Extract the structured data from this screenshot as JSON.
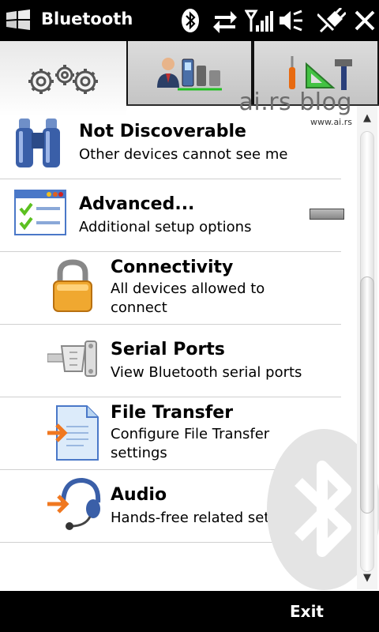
{
  "titlebar": {
    "title": "Bluetooth"
  },
  "status_icons": [
    "bluetooth-icon",
    "data-sync-icon",
    "signal-strength-icon",
    "speaker-icon",
    "power-connected-icon",
    "close-icon"
  ],
  "tabs": [
    {
      "name": "gears-tab",
      "icon": "gears-icon",
      "active": true
    },
    {
      "name": "devices-tab",
      "icon": "person-devices-icon",
      "active": false
    },
    {
      "name": "tools-tab",
      "icon": "tools-icon",
      "active": false
    }
  ],
  "watermark": {
    "title": "ai.rs blog",
    "url": "www.ai.rs"
  },
  "list": {
    "items": [
      {
        "title": "Not Discoverable",
        "subtitle": "Other devices cannot see me",
        "icon": "binoculars-icon"
      },
      {
        "title": "Advanced...",
        "subtitle": "Additional setup options",
        "icon": "checklist-icon"
      },
      {
        "title": "Connectivity",
        "subtitle": "All devices allowed to connect",
        "icon": "lock-icon"
      },
      {
        "title": "Serial Ports",
        "subtitle": "View Bluetooth serial ports",
        "icon": "serial-port-icon"
      },
      {
        "title": "File Transfer",
        "subtitle": "Configure File Transfer settings",
        "icon": "file-transfer-icon"
      },
      {
        "title": "Audio",
        "subtitle": "Hands-free related settings",
        "icon": "headset-icon"
      }
    ]
  },
  "softkeys": {
    "right": "Exit"
  },
  "colors": {
    "bar": "#000000",
    "accent_orange": "#f07820",
    "icon_blue": "#3a5fa8"
  }
}
